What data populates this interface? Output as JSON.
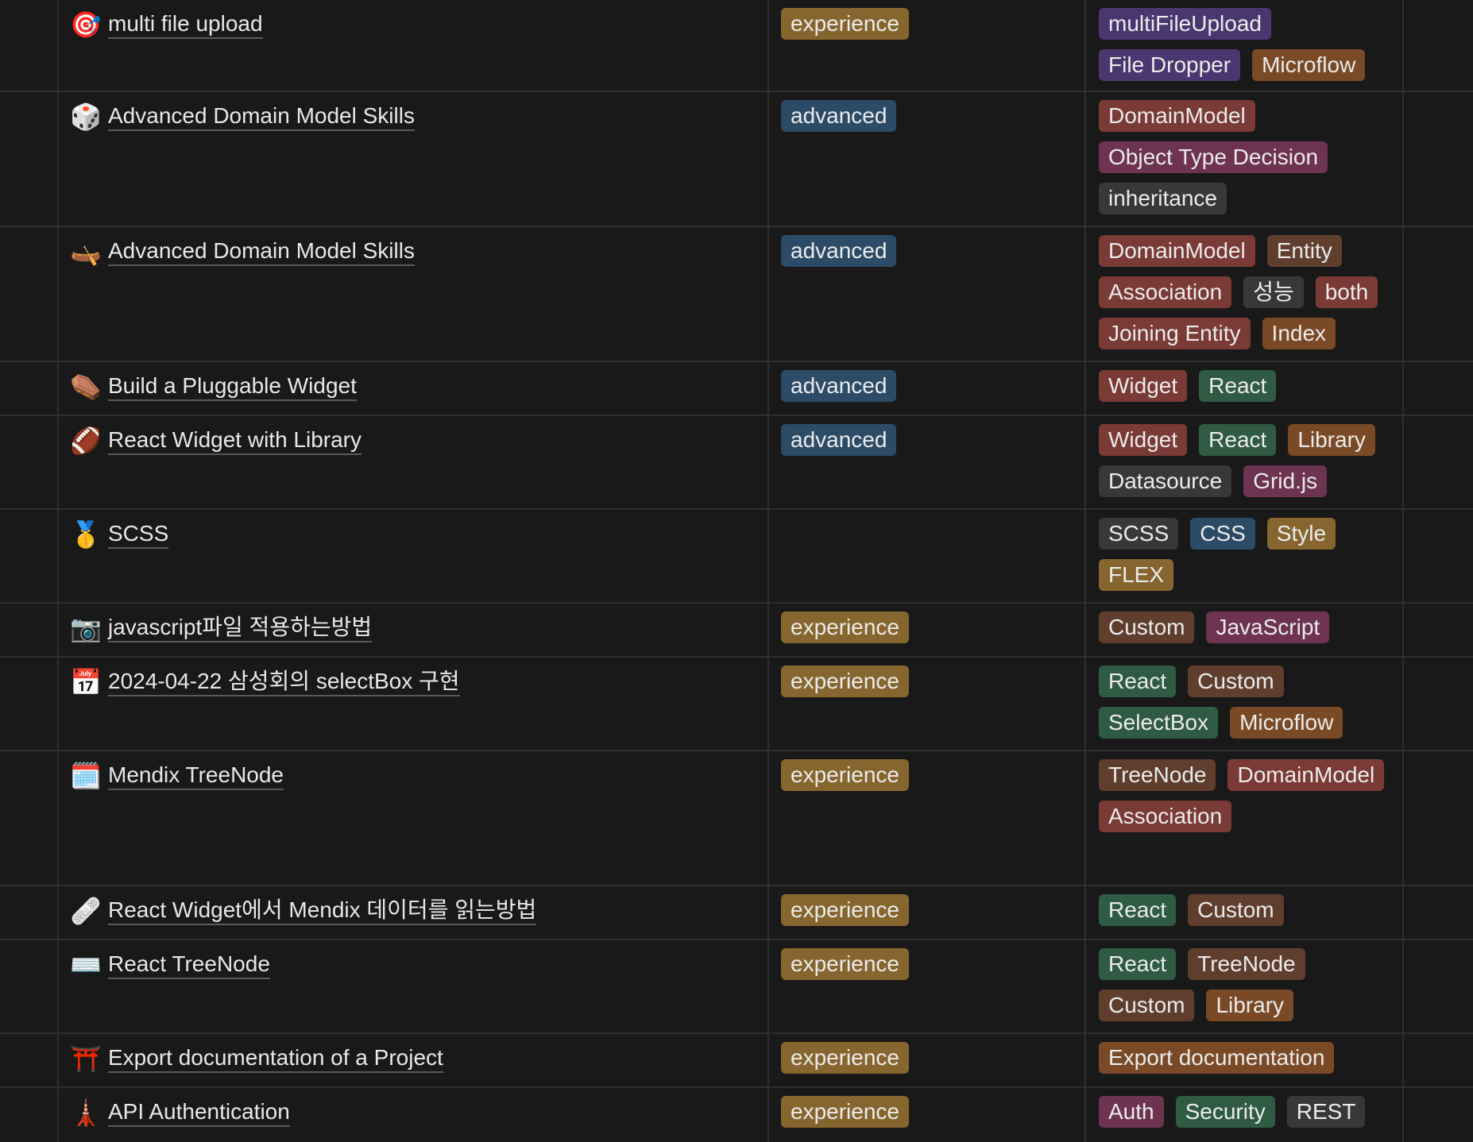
{
  "rows": [
    {
      "icon": "🎯",
      "icon_name": "target-icon",
      "title": "multi file upload",
      "type": "experience",
      "type_color": "yellow",
      "tags": [
        {
          "label": "multiFileUpload",
          "color": "purple"
        },
        {
          "label": "File Dropper",
          "color": "purple"
        },
        {
          "label": "Microflow",
          "color": "orange"
        }
      ]
    },
    {
      "icon": "🎲",
      "icon_name": "dice-icon",
      "title": "Advanced Domain Model Skills",
      "type": "advanced",
      "type_color": "blue",
      "tags": [
        {
          "label": "DomainModel",
          "color": "red"
        },
        {
          "label": "Object Type Decision",
          "color": "pink"
        },
        {
          "label": "inheritance",
          "color": "gray"
        }
      ]
    },
    {
      "icon": "🛶",
      "icon_name": "canoe-icon",
      "title": "Advanced Domain Model Skills",
      "type": "advanced",
      "type_color": "blue",
      "tags": [
        {
          "label": "DomainModel",
          "color": "red"
        },
        {
          "label": "Entity",
          "color": "brown"
        },
        {
          "label": "Association",
          "color": "red"
        },
        {
          "label": "성능",
          "color": "gray"
        },
        {
          "label": "both",
          "color": "red"
        },
        {
          "label": "Joining Entity",
          "color": "red"
        },
        {
          "label": "Index",
          "color": "orange"
        }
      ]
    },
    {
      "icon": "⚰️",
      "icon_name": "coffin-icon",
      "title": "Build a Pluggable Widget",
      "type": "advanced",
      "type_color": "blue",
      "tags": [
        {
          "label": "Widget",
          "color": "red"
        },
        {
          "label": "React",
          "color": "green"
        }
      ]
    },
    {
      "icon": "🏈",
      "icon_name": "football-icon",
      "title": "React Widget with Library",
      "type": "advanced",
      "type_color": "blue",
      "tags": [
        {
          "label": "Widget",
          "color": "red"
        },
        {
          "label": "React",
          "color": "green"
        },
        {
          "label": "Library",
          "color": "orange"
        },
        {
          "label": "Datasource",
          "color": "gray"
        },
        {
          "label": "Grid.js",
          "color": "pink"
        }
      ]
    },
    {
      "icon": "🥇",
      "icon_name": "medal-icon",
      "title": "SCSS",
      "type": "",
      "type_color": "",
      "tags": [
        {
          "label": "SCSS",
          "color": "gray"
        },
        {
          "label": "CSS",
          "color": "blue"
        },
        {
          "label": "Style",
          "color": "yellow"
        },
        {
          "label": "FLEX",
          "color": "yellow"
        }
      ]
    },
    {
      "icon": "📷",
      "icon_name": "camera-icon",
      "title": "javascript파일 적용하는방법",
      "type": "experience",
      "type_color": "yellow",
      "tags": [
        {
          "label": "Custom",
          "color": "brown"
        },
        {
          "label": "JavaScript",
          "color": "pink"
        }
      ]
    },
    {
      "icon": "📅",
      "icon_name": "calendar-icon",
      "title": "2024-04-22 삼성회의 selectBox 구현",
      "type": "experience",
      "type_color": "yellow",
      "tags": [
        {
          "label": "React",
          "color": "green"
        },
        {
          "label": "Custom",
          "color": "brown"
        },
        {
          "label": "SelectBox",
          "color": "green"
        },
        {
          "label": "Microflow",
          "color": "orange"
        }
      ]
    },
    {
      "icon": "🗓️",
      "icon_name": "spiral-calendar-icon",
      "title": "Mendix TreeNode",
      "type": "experience",
      "type_color": "yellow",
      "tags": [
        {
          "label": "TreeNode",
          "color": "brown"
        },
        {
          "label": "DomainModel",
          "color": "red"
        },
        {
          "label": "Association",
          "color": "red"
        }
      ]
    },
    {
      "icon": "🩹",
      "icon_name": "bandage-icon",
      "title": "React Widget에서 Mendix 데이터를 읽는방법",
      "type": "experience",
      "type_color": "yellow",
      "tags": [
        {
          "label": "React",
          "color": "green"
        },
        {
          "label": "Custom",
          "color": "brown"
        }
      ]
    },
    {
      "icon": "⌨️",
      "icon_name": "keyboard-icon",
      "title": "React TreeNode",
      "type": "experience",
      "type_color": "yellow",
      "tags": [
        {
          "label": "React",
          "color": "green"
        },
        {
          "label": "TreeNode",
          "color": "brown"
        },
        {
          "label": "Custom",
          "color": "brown"
        },
        {
          "label": "Library",
          "color": "orange"
        }
      ]
    },
    {
      "icon": "⛩️",
      "icon_name": "torii-gate-icon",
      "title": "Export documentation of a Project",
      "type": "experience",
      "type_color": "yellow",
      "tags": [
        {
          "label": "Export documentation",
          "color": "orange"
        }
      ]
    },
    {
      "icon": "🗼",
      "icon_name": "tower-icon",
      "title": "API Authentication",
      "type": "experience",
      "type_color": "yellow",
      "tags": [
        {
          "label": "Auth",
          "color": "pink"
        },
        {
          "label": "Security",
          "color": "green"
        },
        {
          "label": "REST",
          "color": "gray"
        }
      ]
    }
  ]
}
